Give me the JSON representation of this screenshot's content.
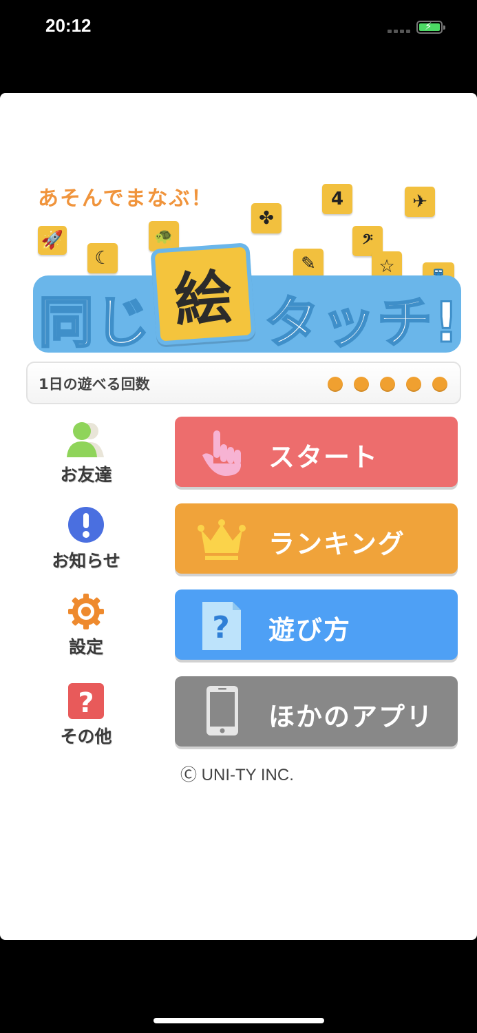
{
  "status_bar": {
    "time": "20:12"
  },
  "logo": {
    "tagline": "あそんでまなぶ！",
    "title_left": "同じ",
    "title_kanji": "絵",
    "title_right": "タッチ!",
    "tiles": [
      "🚀",
      "☾",
      "🐢",
      "✤",
      "4",
      "✈",
      "𝄢",
      "✎",
      "☆",
      "🚆"
    ]
  },
  "play_count": {
    "label": "1日の遊べる回数",
    "remaining": 5
  },
  "side_menu": {
    "friends": "お友達",
    "news": "お知らせ",
    "settings": "設定",
    "other": "その他"
  },
  "buttons": {
    "start": "スタート",
    "ranking": "ランキング",
    "how_to_play": "遊び方",
    "other_apps": "ほかのアプリ"
  },
  "copyright": "Ⓒ UNI-TY INC.",
  "colors": {
    "start": "#ed6d6d",
    "ranking": "#f0a33a",
    "how_to_play": "#4ea0f5",
    "other_apps": "#888888",
    "logo_band": "#6ab6ea",
    "tile": "#f2c03e"
  }
}
